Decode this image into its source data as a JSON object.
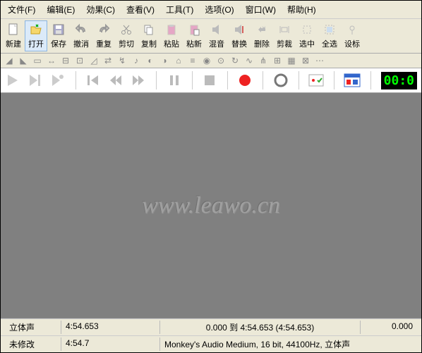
{
  "menu": {
    "file": "文件(F)",
    "edit": "编辑(E)",
    "effects": "効果(C)",
    "view": "查看(V)",
    "tools": "工具(T)",
    "options": "选项(O)",
    "window": "窗口(W)",
    "help": "帮助(H)"
  },
  "toolbar": {
    "new": "新建",
    "open": "打开",
    "save": "保存",
    "undo": "撤消",
    "redo": "重复",
    "cut": "剪切",
    "copy": "复制",
    "paste": "粘贴",
    "paste_new": "粘新",
    "mix": "混音",
    "replace": "替换",
    "delete": "删除",
    "trim": "剪裁",
    "select": "选中",
    "select_all": "全选",
    "markers": "设标"
  },
  "timer": "00:0",
  "watermark": "www.leawo.cn",
  "status": {
    "channels": "立体声",
    "duration1": "4:54.653",
    "selection": "0.000 到 4:54.653 (4:54.653)",
    "position": "0.000",
    "modified": "未修改",
    "duration2": "4:54.7",
    "format": "Monkey's Audio Medium, 16 bit, 44100Hz, 立体声"
  }
}
